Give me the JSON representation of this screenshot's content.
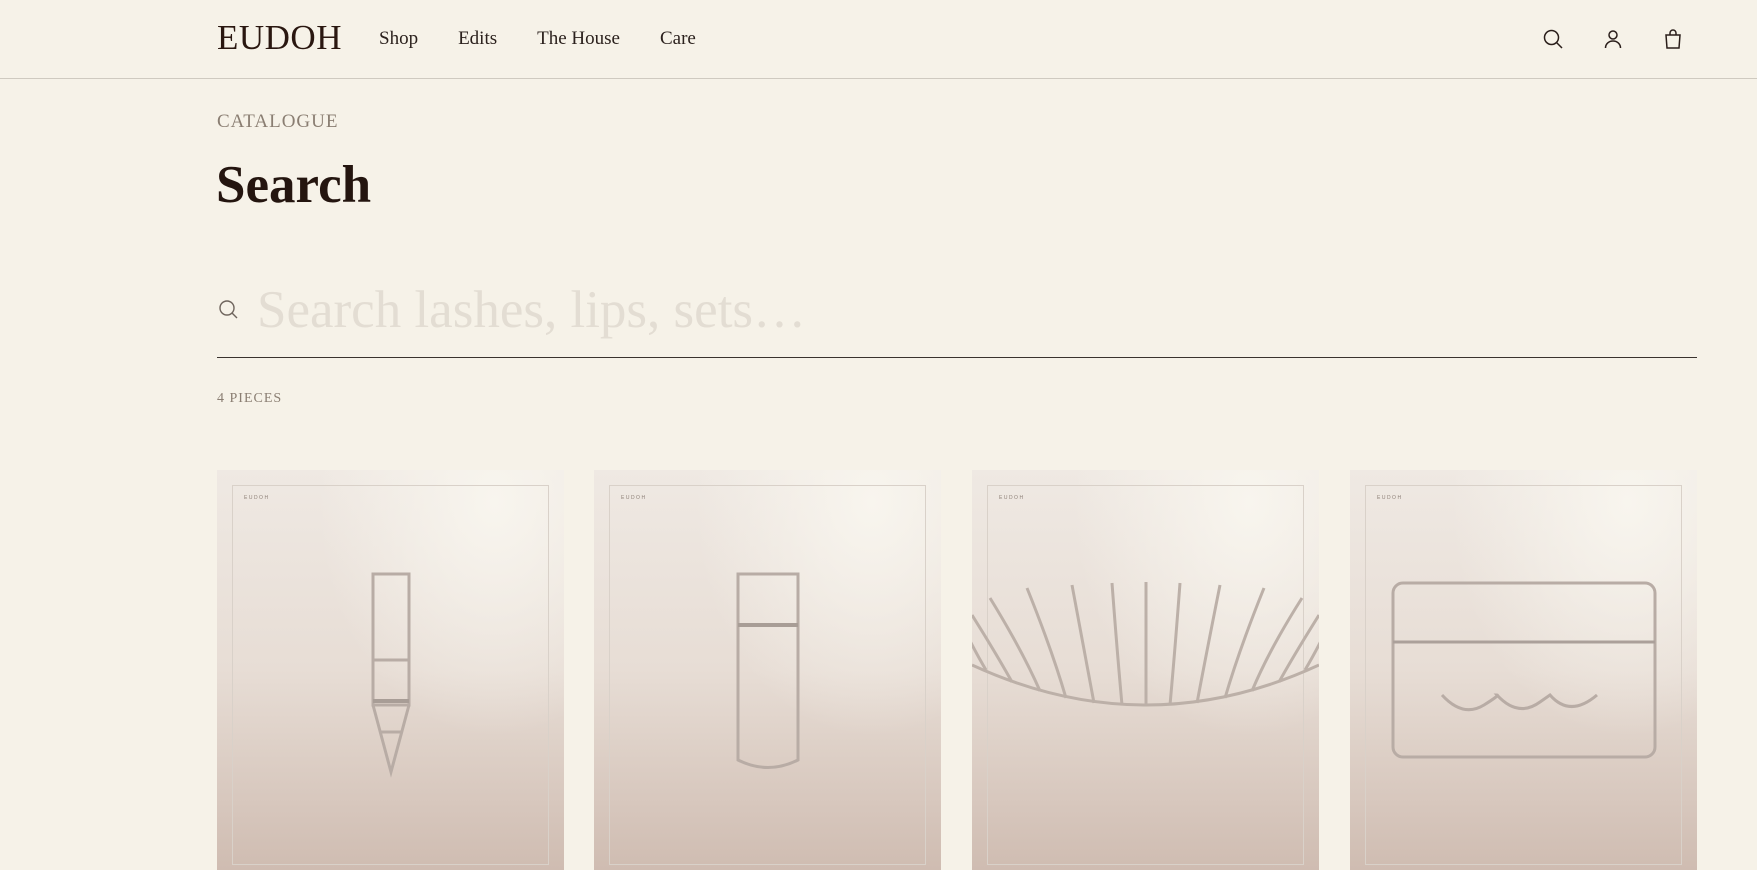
{
  "brand": "EUDOH",
  "nav": [
    "Shop",
    "Edits",
    "The House",
    "Care"
  ],
  "header_icons": [
    "search-icon",
    "account-icon",
    "bag-icon"
  ],
  "eyebrow": "CATALOGUE",
  "title": "Search",
  "search": {
    "placeholder": "Search lashes, lips, sets…",
    "value": ""
  },
  "count": "4 PIECES",
  "products": [
    {
      "mark": "EUDOH",
      "illustration": "pencil"
    },
    {
      "mark": "EUDOH",
      "illustration": "tube"
    },
    {
      "mark": "EUDOH",
      "illustration": "lash-strip"
    },
    {
      "mark": "EUDOH",
      "illustration": "lash-case"
    }
  ],
  "colors": {
    "background": "#f6f2e8",
    "text": "#2a1e1a",
    "muted": "#8a7e72",
    "rule": "#3a332e"
  }
}
